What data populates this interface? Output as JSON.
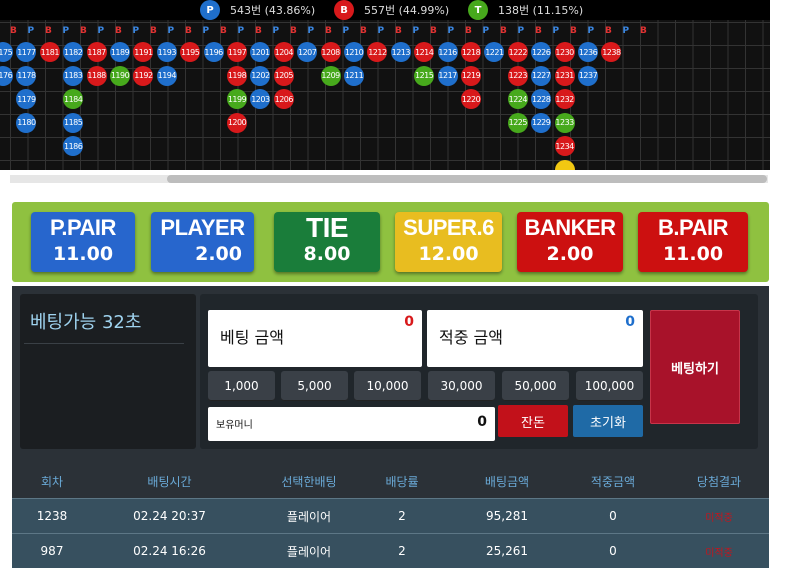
{
  "stats": [
    {
      "icon": "P",
      "text": "543번 (43.86%)",
      "color": "#1f6fcc"
    },
    {
      "icon": "B",
      "text": "557번 (44.99%)",
      "color": "#d8191b"
    },
    {
      "icon": "T",
      "text": "138번 (11.15%)",
      "color": "#47a91c"
    }
  ],
  "road": {
    "header_letters": [
      "B",
      "P",
      "B",
      "P",
      "B",
      "P",
      "B",
      "P",
      "B",
      "P",
      "B",
      "P",
      "B",
      "P",
      "B",
      "P",
      "B",
      "P",
      "B",
      "P",
      "B",
      "P",
      "B",
      "P",
      "B",
      "P",
      "B",
      "P",
      "B",
      "P",
      "B",
      "P",
      "B",
      "P",
      "B",
      "P",
      "B"
    ],
    "columns": [
      [
        {
          "n": "1175",
          "c": "P"
        },
        {
          "n": "1176",
          "c": "P"
        }
      ],
      [
        {
          "n": "1177",
          "c": "P"
        },
        {
          "n": "1178",
          "c": "P"
        },
        {
          "n": "1179",
          "c": "P"
        },
        {
          "n": "1180",
          "c": "P"
        }
      ],
      [
        {
          "n": "1181",
          "c": "B"
        }
      ],
      [
        {
          "n": "1182",
          "c": "P"
        },
        {
          "n": "1183",
          "c": "P"
        },
        {
          "n": "1184",
          "c": "T"
        },
        {
          "n": "1185",
          "c": "P"
        },
        {
          "n": "1186",
          "c": "P"
        }
      ],
      [
        {
          "n": "1187",
          "c": "B"
        },
        {
          "n": "1188",
          "c": "B"
        }
      ],
      [
        {
          "n": "1189",
          "c": "P"
        },
        {
          "n": "1190",
          "c": "T"
        }
      ],
      [
        {
          "n": "1191",
          "c": "B"
        },
        {
          "n": "1192",
          "c": "B"
        }
      ],
      [
        {
          "n": "1193",
          "c": "P"
        },
        {
          "n": "1194",
          "c": "P"
        }
      ],
      [
        {
          "n": "1195",
          "c": "B"
        }
      ],
      [
        {
          "n": "1196",
          "c": "P"
        }
      ],
      [
        {
          "n": "1197",
          "c": "B"
        },
        {
          "n": "1198",
          "c": "B"
        },
        {
          "n": "1199",
          "c": "T"
        },
        {
          "n": "1200",
          "c": "B"
        }
      ],
      [
        {
          "n": "1201",
          "c": "P"
        },
        {
          "n": "1202",
          "c": "P"
        },
        {
          "n": "1203",
          "c": "P"
        }
      ],
      [
        {
          "n": "1204",
          "c": "B"
        },
        {
          "n": "1205",
          "c": "B"
        },
        {
          "n": "1206",
          "c": "B"
        }
      ],
      [
        {
          "n": "1207",
          "c": "P"
        }
      ],
      [
        {
          "n": "1208",
          "c": "B"
        },
        {
          "n": "1209",
          "c": "T"
        }
      ],
      [
        {
          "n": "1210",
          "c": "P"
        },
        {
          "n": "1211",
          "c": "P"
        }
      ],
      [
        {
          "n": "1212",
          "c": "B"
        }
      ],
      [
        {
          "n": "1213",
          "c": "P"
        }
      ],
      [
        {
          "n": "1214",
          "c": "B"
        },
        {
          "n": "1215",
          "c": "T"
        }
      ],
      [
        {
          "n": "1216",
          "c": "P"
        },
        {
          "n": "1217",
          "c": "P"
        }
      ],
      [
        {
          "n": "1218",
          "c": "B"
        },
        {
          "n": "1219",
          "c": "B"
        },
        {
          "n": "1220",
          "c": "B"
        }
      ],
      [
        {
          "n": "1221",
          "c": "P"
        }
      ],
      [
        {
          "n": "1222",
          "c": "B"
        },
        {
          "n": "1223",
          "c": "B"
        },
        {
          "n": "1224",
          "c": "T"
        },
        {
          "n": "1225",
          "c": "T"
        }
      ],
      [
        {
          "n": "1226",
          "c": "P"
        },
        {
          "n": "1227",
          "c": "P"
        },
        {
          "n": "1228",
          "c": "P"
        },
        {
          "n": "1229",
          "c": "P"
        }
      ],
      [
        {
          "n": "1230",
          "c": "B"
        },
        {
          "n": "1231",
          "c": "B"
        },
        {
          "n": "1232",
          "c": "B"
        },
        {
          "n": "1233",
          "c": "T"
        },
        {
          "n": "1234",
          "c": "B"
        },
        {
          "n": "",
          "c": "Y"
        }
      ],
      [
        {
          "n": "1236",
          "c": "P"
        },
        {
          "n": "1237",
          "c": "P"
        }
      ],
      [
        {
          "n": "1238",
          "c": "B"
        }
      ]
    ]
  },
  "bets": [
    {
      "name": "P.PAIR",
      "odds": "11.00",
      "color": "blue"
    },
    {
      "name": "PLAYER",
      "odds": "2.00",
      "color": "blue"
    },
    {
      "name": "TIE",
      "odds": "8.00",
      "color": "green"
    },
    {
      "name": "SUPER.6",
      "odds": "12.00",
      "color": "yellow"
    },
    {
      "name": "BANKER",
      "odds": "2.00",
      "color": "red"
    },
    {
      "name": "B.PAIR",
      "odds": "11.00",
      "color": "red"
    }
  ],
  "panel": {
    "timer_text": "베팅가능 32초",
    "bet_amount_label": "베팅 금액",
    "bet_amount_value": "0",
    "win_amount_label": "적중 금액",
    "win_amount_value": "0",
    "chips": [
      "1,000",
      "5,000",
      "10,000",
      "30,000",
      "50,000",
      "100,000"
    ],
    "money_label": "보유머니",
    "money_value": "0",
    "change_label": "잔돈",
    "reset_label": "초기화",
    "place_bet_label": "베팅하기"
  },
  "history": {
    "headers": [
      "회차",
      "배팅시간",
      "선택한배팅",
      "배당률",
      "배팅금액",
      "적중금액",
      "당첨결과"
    ],
    "rows": [
      [
        "1238",
        "02.24 20:37",
        "플레이어",
        "2",
        "95,281",
        "0",
        "미적중"
      ],
      [
        "987",
        "02.24 16:26",
        "플레이어",
        "2",
        "25,261",
        "0",
        "미적중"
      ]
    ]
  },
  "colors": {
    "player": "#1f6fcc",
    "banker": "#d8191b",
    "tie": "#47a91c",
    "board": "#8fc140"
  }
}
